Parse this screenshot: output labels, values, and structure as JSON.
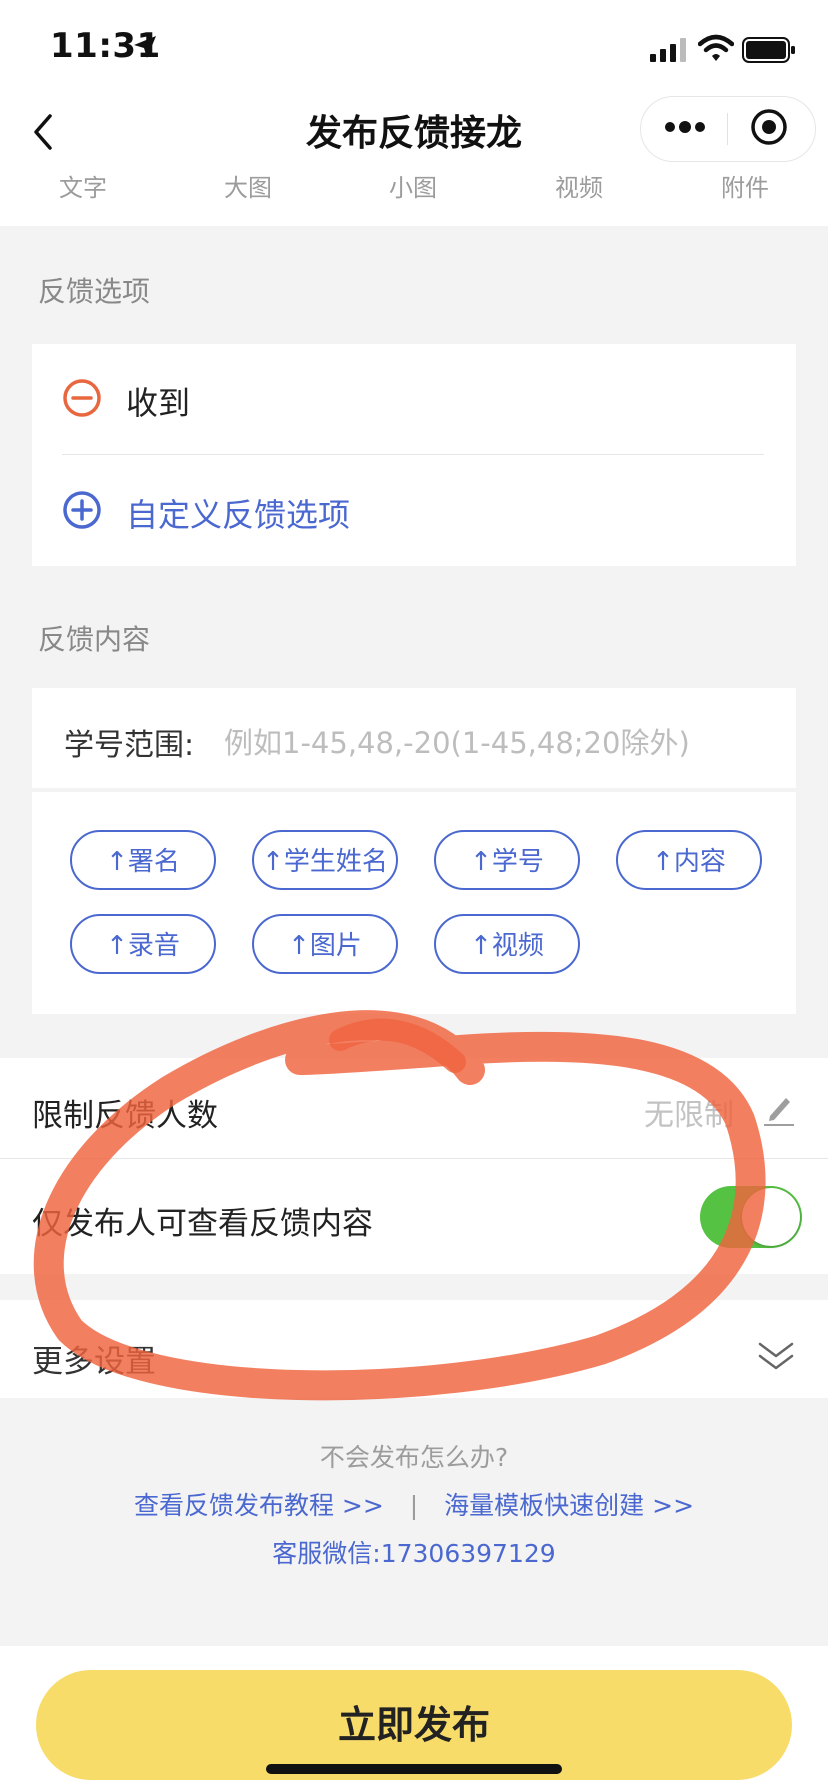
{
  "status": {
    "time": "11:31"
  },
  "nav": {
    "title": "发布反馈接龙"
  },
  "tabs": [
    "文字",
    "大图",
    "小图",
    "视频",
    "附件"
  ],
  "feedback_options": {
    "section_title": "反馈选项",
    "items": [
      {
        "label": "收到"
      }
    ],
    "add_label": "自定义反馈选项"
  },
  "feedback_content": {
    "section_title": "反馈内容",
    "id_range_label": "学号范围:",
    "id_range_placeholder": "例如1-45,48,-20(1-45,48;20除外)",
    "chips": [
      "↑署名",
      "↑学生姓名",
      "↑学号",
      "↑内容",
      "↑录音",
      "↑图片",
      "↑视频"
    ]
  },
  "settings": {
    "limit_label": "限制反馈人数",
    "limit_value": "无限制",
    "private_label": "仅发布人可查看反馈内容",
    "private_enabled": true,
    "more_label": "更多设置"
  },
  "help": {
    "question": "不会发布怎么办?",
    "tutorial_link": "查看反馈发布教程 >>",
    "separator": "|",
    "template_link": "海量模板快速创建 >>",
    "service": "客服微信:17306397129"
  },
  "publish_button": "立即发布",
  "colors": {
    "accent_blue": "#4a68d0",
    "remove_orange": "#e8673f",
    "toggle_green": "#55c243",
    "publish_yellow": "#f7dc6a",
    "annotation_red": "#f0633e"
  }
}
